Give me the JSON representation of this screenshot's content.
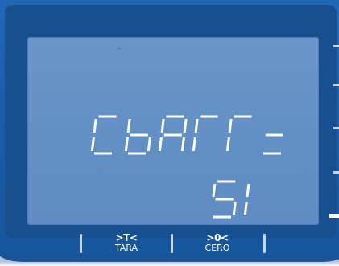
{
  "display": {
    "line1": "CbAГГ=",
    "line2": "51",
    "color": "#ffffff",
    "background": "#6a95c8"
  },
  "keys": [
    {
      "symbol": ">T<",
      "label": "TARA"
    },
    {
      "symbol": ">0<",
      "label": "CERO"
    }
  ],
  "colors": {
    "bezel": "#1a5ea9",
    "lcd": "#6a95c8",
    "segment": "#ffffff"
  }
}
